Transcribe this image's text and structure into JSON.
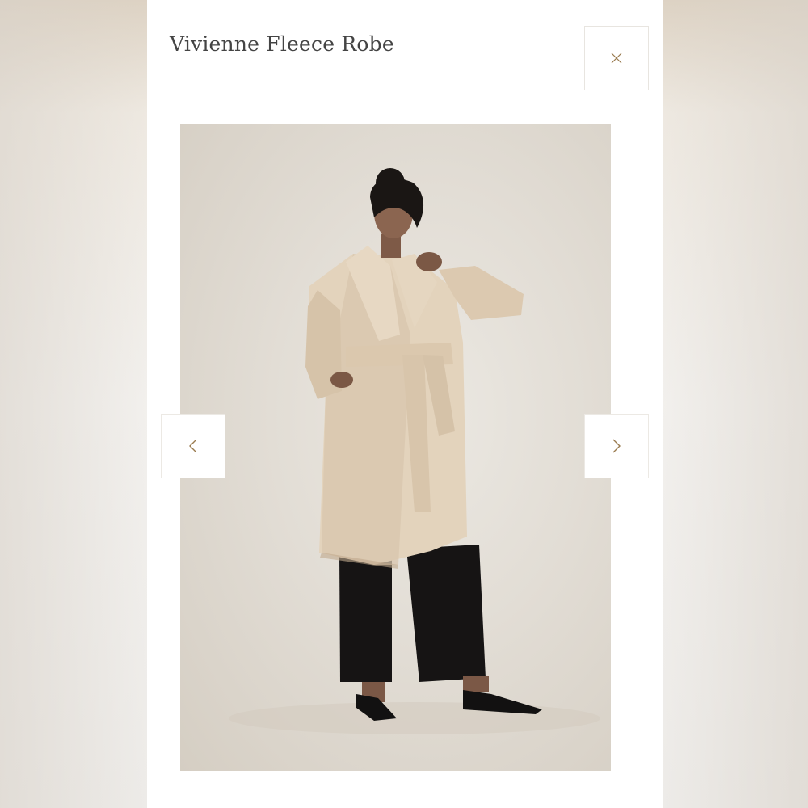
{
  "modal": {
    "title": "Vivienne Fleece Robe"
  },
  "icons": {
    "close": "close-icon",
    "previous": "chevron-left-icon",
    "next": "chevron-right-icon"
  },
  "image": {
    "alt": "Model wearing a beige fleece robe with black wide-leg pants and black pointed flats"
  },
  "colors": {
    "accent": "#9a7b4f",
    "title": "#444444",
    "border": "#e8e5e0"
  }
}
